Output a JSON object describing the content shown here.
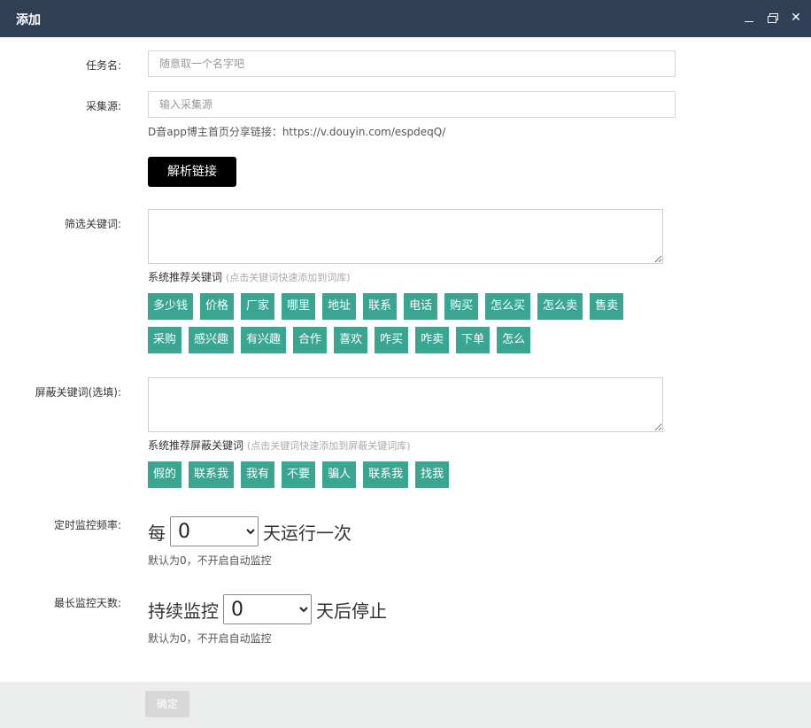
{
  "window": {
    "title": "添加",
    "controls": {
      "minimize": "minimize-icon",
      "maximize": "maximize-icon",
      "close_glyph": "✕"
    }
  },
  "form": {
    "task_name": {
      "label": "任务名:",
      "placeholder": "随意取一个名字吧",
      "value": ""
    },
    "source": {
      "label": "采集源:",
      "placeholder": "输入采集源",
      "value": "",
      "hint": "D音app博主首页分享链接：https://v.douyin.com/espdeqQ/"
    },
    "parse_button": "解析链接",
    "filter_keywords": {
      "label": "筛选关键词:",
      "value": "",
      "recommend_title": "系统推荐关键词",
      "recommend_sub": "(点击关键词快速添加到词库)",
      "tags_row1": [
        "多少钱",
        "价格",
        "厂家",
        "哪里",
        "地址",
        "联系",
        "电话",
        "购买",
        "怎么买",
        "怎么卖",
        "售卖"
      ],
      "tags_row2": [
        "采购",
        "感兴趣",
        "有兴趣",
        "合作",
        "喜欢",
        "咋买",
        "咋卖",
        "下单",
        "怎么"
      ]
    },
    "block_keywords": {
      "label": "屏蔽关键词(选填):",
      "value": "",
      "recommend_title": "系统推荐屏蔽关键词",
      "recommend_sub": "(点击关键词快速添加到屏蔽关键词库)",
      "tags": [
        "假的",
        "联系我",
        "我有",
        "不要",
        "骗人",
        "联系我",
        "找我"
      ]
    },
    "monitor_freq": {
      "label": "定时监控频率:",
      "prefix": "每",
      "selected": "0",
      "suffix": "天运行一次",
      "note": "默认为0，不开启自动监控"
    },
    "max_days": {
      "label": "最长监控天数:",
      "prefix": "持续监控",
      "selected": "0",
      "suffix": "天后停止",
      "note": "默认为0，不开启自动监控"
    }
  },
  "footer": {
    "confirm": "确定"
  },
  "colors": {
    "titlebar": "#2f4056",
    "tag": "#3aa692",
    "parse_button": "#000000",
    "footer": "#eceeee"
  }
}
